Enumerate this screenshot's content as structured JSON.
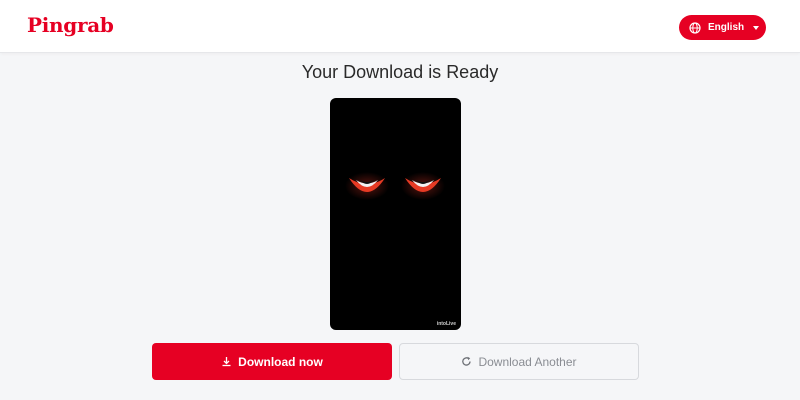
{
  "header": {
    "logo_text": "Pingrab",
    "language": {
      "label": "English",
      "icon": "globe-icon",
      "caret_icon": "caret-down-icon"
    }
  },
  "main": {
    "title": "Your Download is Ready",
    "preview": {
      "watermark": "intoLive"
    },
    "actions": {
      "download_now_label": "Download now",
      "download_now_icon": "download-icon",
      "download_another_label": "Download Another",
      "download_another_icon": "refresh-icon"
    }
  },
  "colors": {
    "brand": "#e60023",
    "background": "#f5f6f8",
    "header_bg": "#ffffff",
    "preview_bg": "#000000"
  }
}
